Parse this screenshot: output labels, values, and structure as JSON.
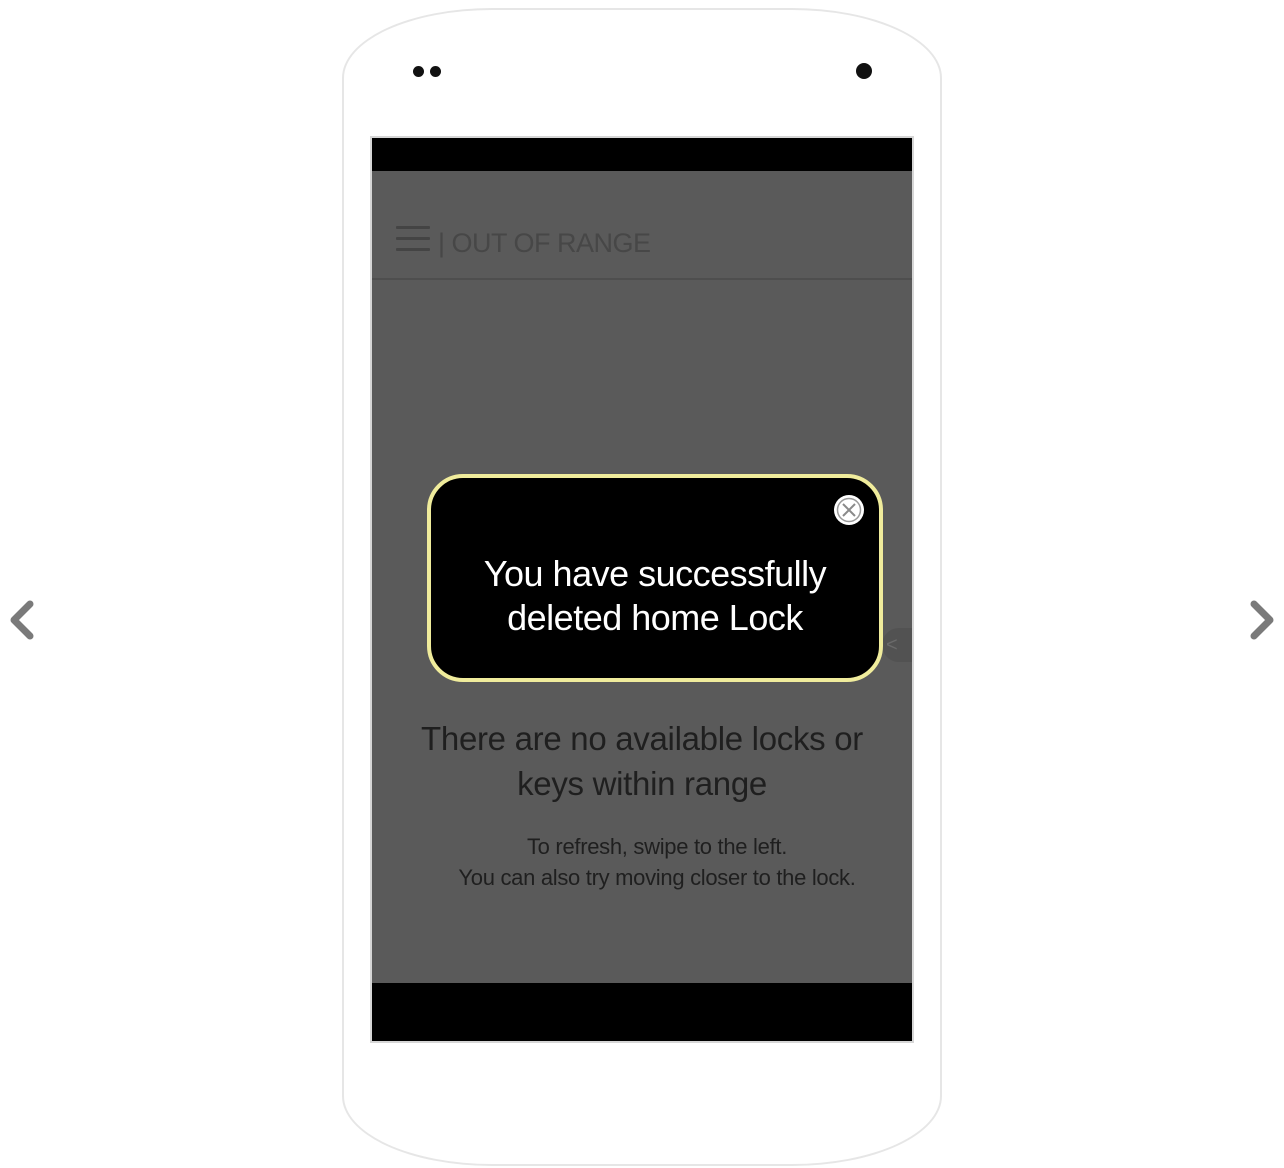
{
  "gallery": {
    "prev_icon": "chevron-left-icon",
    "next_icon": "chevron-right-icon"
  },
  "app": {
    "title": "| OUT OF RANGE",
    "menu_icon": "hamburger-menu-icon",
    "side_tab_icon": "chevron-left-icon",
    "side_tab_glyph": "<"
  },
  "empty_state": {
    "title": "There are no available locks or keys within range",
    "hint_line1": "To refresh, swipe to the left.",
    "hint_line2": "You can also try moving closer to the lock."
  },
  "toast": {
    "message": "You have successfully deleted home Lock",
    "close_icon": "close-circle-icon"
  },
  "colors": {
    "overlay": "#5a5a5a",
    "toast_bg": "#000000",
    "toast_border": "#f0ec9c",
    "arrow": "#7a7a7a"
  }
}
